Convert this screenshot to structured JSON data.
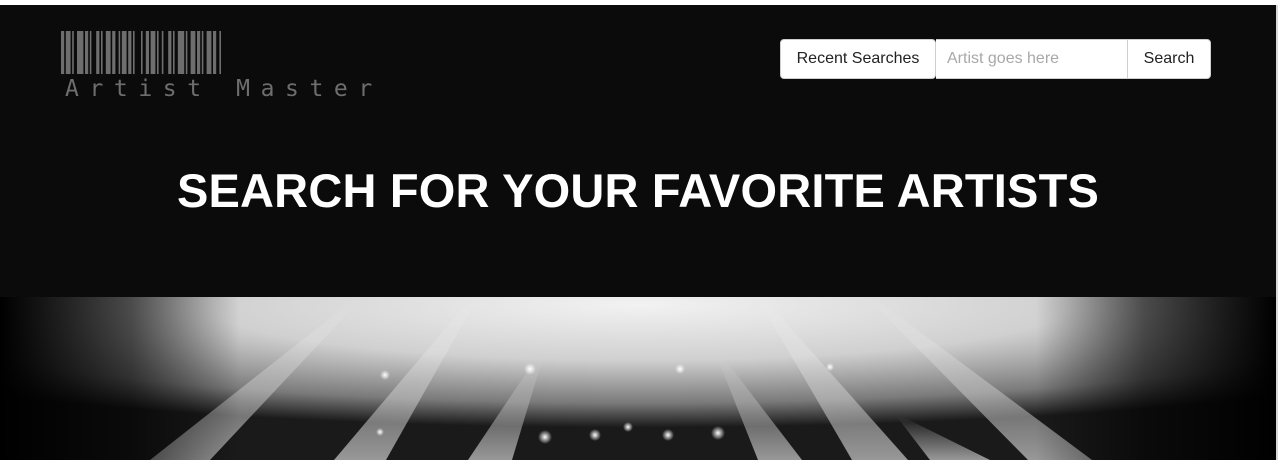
{
  "header": {
    "logo_text": "Artist Master",
    "logo_icon": "barcode-icon"
  },
  "nav": {
    "recent_searches_label": "Recent Searches",
    "search_placeholder": "Artist goes here",
    "search_value": "",
    "search_button_label": "Search"
  },
  "hero": {
    "headline": "SEARCH FOR YOUR FAVORITE ARTISTS"
  },
  "colors": {
    "page_background": "#0b0b0b",
    "headline": "#ffffff",
    "logo": "#6e6e6e",
    "button_background": "#ffffff"
  }
}
